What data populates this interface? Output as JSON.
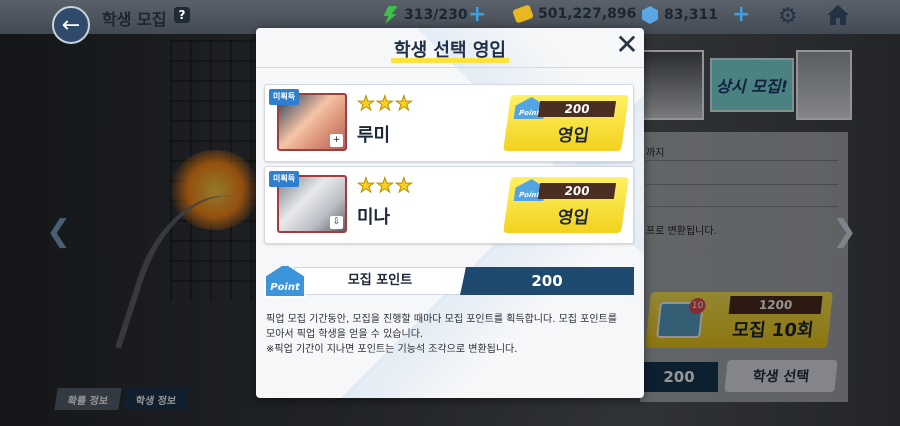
{
  "topbar": {
    "title": "학생 모집",
    "help": "?",
    "stamina": "313/230",
    "credits": "501,227,896",
    "gems": "83,311"
  },
  "background": {
    "always_recruit": "상시 모집!",
    "info_line1": "까지",
    "info_line2": "프로 변환됩니다.",
    "recruit10_cost": "1200",
    "recruit10_label": "모집 10회",
    "mail_badge": "10",
    "point_value": "200",
    "student_select": "학생 선택",
    "tab_rates": "확률 정보",
    "tab_students": "학생 정보"
  },
  "modal": {
    "title": "학생 선택 영입",
    "students": [
      {
        "badge": "미획득",
        "name": "루미",
        "stars": "★★★",
        "cost": "200",
        "action": "영입"
      },
      {
        "badge": "미획득",
        "name": "미나",
        "stars": "★★★",
        "cost": "200",
        "action": "영입"
      }
    ],
    "point_icon_text": "Point",
    "point_label": "모집 포인트",
    "point_value": "200",
    "description": [
      "픽업 모집 기간동안, 모집을 진행할 때마다 모집 포인트를 획득합니다. 모집 포인트를",
      "모아서 픽업 학생을 얻을 수 있습니다.",
      "※픽업 기간이 지나면 포인트는 기능석 조각으로 변환됩니다."
    ]
  },
  "colors": {
    "accent_yellow": "#f2d21e",
    "point_navy": "#1f4a70",
    "badge_blue": "#2f7fd0"
  }
}
